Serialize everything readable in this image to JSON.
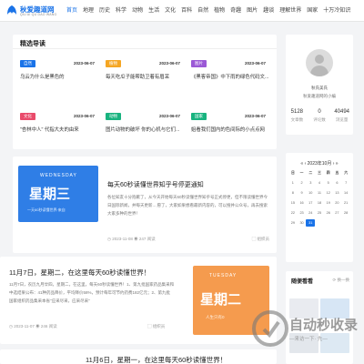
{
  "site": {
    "name": "秋爱趣道网",
    "sub": "QIU AI QU DAO WANG"
  },
  "nav": [
    "首页",
    "地理",
    "历史",
    "科学",
    "动物",
    "生活",
    "文化",
    "百科",
    "自然",
    "植物",
    "奇趣",
    "图片",
    "趣谈",
    "理解世界",
    "国家",
    "十万冷知识"
  ],
  "guide": {
    "title": "精选导读",
    "items": [
      {
        "tag": "自然",
        "color": "#1a73e8",
        "date": "2023-06-07",
        "title": "乌云为什么是黑色的"
      },
      {
        "tag": "植物",
        "color": "#f5a623",
        "date": "2023-06-07",
        "title": "每天吃瓜子能帮助卫着有眉呆"
      },
      {
        "tag": "图片",
        "color": "#9b59d6",
        "date": "2023-06-07",
        "title": "《黑客帝国》中下雨的绿色代码文..."
      },
      {
        "tag": "文化",
        "color": "#e94b6b",
        "date": "2023-06-07",
        "title": "\"杏林中人\" 代指大夫的由来"
      },
      {
        "tag": "动物",
        "color": "#18b37f",
        "date": "2023-06-07",
        "title": "图片动物的破坏 你的心机与它们..."
      },
      {
        "tag": "国家",
        "color": "#18b37f",
        "date": "2023-06-07",
        "title": "姐看我们国内的色间际的小点点网"
      }
    ]
  },
  "profile": {
    "name": "秋氏美氏",
    "desc": "秋爱趣道网的小编",
    "stats": [
      {
        "num": "5128",
        "label": "文章数"
      },
      {
        "num": "0",
        "label": "评论数"
      },
      {
        "num": "40494",
        "label": "浏览量"
      }
    ]
  },
  "calendar": {
    "title": "2023年10月",
    "weekdays": [
      "日",
      "一",
      "二",
      "三",
      "四",
      "五",
      "六"
    ],
    "days": [
      "1",
      "2",
      "3",
      "4",
      "5",
      "6",
      "7",
      "8",
      "9",
      "10",
      "11",
      "12",
      "13",
      "14",
      "15",
      "16",
      "17",
      "18",
      "19",
      "20",
      "21",
      "22",
      "23",
      "24",
      "25",
      "26",
      "27",
      "28",
      "29",
      "30",
      "31"
    ],
    "selected": "31"
  },
  "articles": [
    {
      "title": "每天60秒读懂世界知乎号停更通知",
      "body": "各位知友十分抱歉了，从今天开始每天60秒读懂世界知乎号正式停更，但不限读懂世界今日国际新闻，并每天更新...",
      "body2": "愿了，大家如果想看最新内容的，可以搜并公众号，再去搜索大家多种的世界！",
      "date": "2023-11-08",
      "views": "247 阅读",
      "cat": "组织员",
      "thumb": {
        "en": "WEDNESDAY",
        "day": "星期三",
        "cap": "一天60秒读懂世界·来自"
      }
    },
    {
      "title": "11月7日，星期二，在这里每天60秒读懂世界！",
      "body": "11月7日，农历九月廿四，星期二，在这里，每天60秒读懂世界！1、第九批国家药品集采和",
      "body2": "中选结果公布：41种药品降价，平均降价58%，预计每年可节约药费182亿元；2、第九批",
      "body3": "国家组织药品集采本省\"应采尽采，应采尽采\"",
      "date": "2023-11-07",
      "views": "246 阅读",
      "cat": "组织员",
      "thumb": {
        "en": "TUESDAY",
        "day": "星期二",
        "cap": "人生只有0"
      }
    },
    {
      "title": "11月6日，星期一，在这里每天60秒读懂世界！"
    }
  ],
  "hot": {
    "title": "随便看看",
    "more": "换一换"
  },
  "watermark": {
    "text": "自动秒收录",
    "sub": "—来访一下· 先—"
  }
}
